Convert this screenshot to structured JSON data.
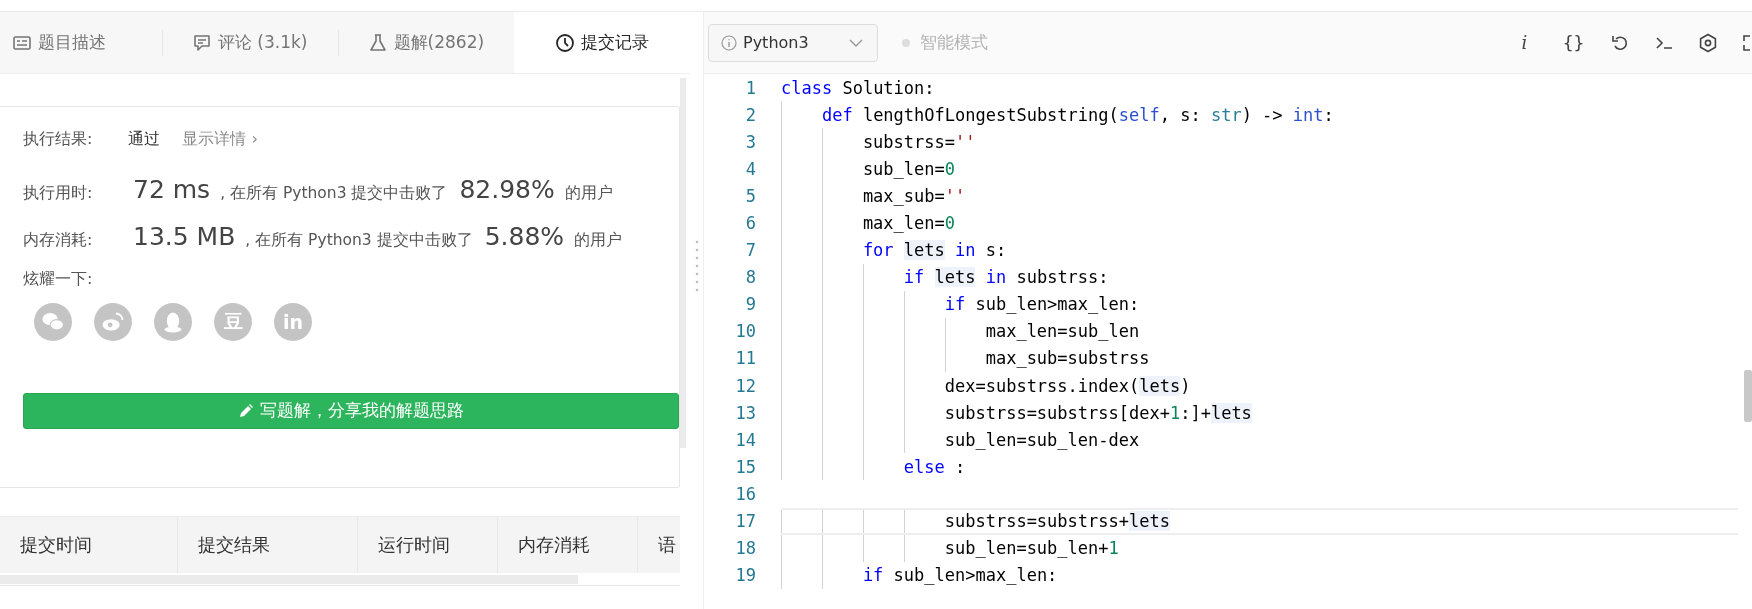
{
  "tabs": [
    {
      "label": "题目描述",
      "selected": false
    },
    {
      "label": "评论 (3.1k)",
      "selected": false
    },
    {
      "label": "题解(2862)",
      "selected": false
    },
    {
      "label": "提交记录",
      "selected": true
    }
  ],
  "result": {
    "label": "执行结果:",
    "status": "通过",
    "details_link": "显示详情 ›"
  },
  "stats": [
    {
      "label": "执行用时:",
      "value": "72 ms",
      "text": ", 在所有 Python3 提交中击败了",
      "percent": "82.98%",
      "suffix": "的用户"
    },
    {
      "label": "内存消耗:",
      "value": "13.5 MB",
      "text": ", 在所有 Python3 提交中击败了",
      "percent": "5.88%",
      "suffix": "的用户"
    }
  ],
  "share": {
    "label": "炫耀一下:",
    "items": [
      {
        "kind": "wechat"
      },
      {
        "kind": "weibo"
      },
      {
        "kind": "qq"
      },
      {
        "kind": "douban",
        "label": "豆"
      },
      {
        "kind": "linkedin",
        "label": "in"
      }
    ]
  },
  "write_button": "写题解，分享我的解题思路",
  "table": {
    "columns": [
      "提交时间",
      "提交结果",
      "运行时间",
      "内存消耗",
      "语"
    ]
  },
  "editor": {
    "language": "Python3",
    "smart_mode": {
      "label": "智能模式",
      "on": false
    },
    "toolbar": [
      {
        "kind": "text",
        "label": "i"
      },
      {
        "kind": "text",
        "label": "{}"
      },
      {
        "kind": "reset"
      },
      {
        "kind": "console"
      },
      {
        "kind": "settings"
      },
      {
        "kind": "fullscreen"
      }
    ],
    "lines": [
      {
        "number": "1",
        "current": false,
        "tokens": [
          {
            "kind": "keyword",
            "text": "class"
          },
          {
            "kind": "plain",
            "text": " Solution:"
          }
        ]
      },
      {
        "number": "2",
        "current": false,
        "tokens": [
          {
            "kind": "keyword",
            "text": "    def"
          },
          {
            "kind": "plain",
            "text": " lengthOfLongestSubstring("
          },
          {
            "kind": "builtin",
            "text": "self"
          },
          {
            "kind": "plain",
            "text": ", s: "
          },
          {
            "kind": "type",
            "text": "str"
          },
          {
            "kind": "plain",
            "text": ") -> "
          },
          {
            "kind": "builtin",
            "text": "int"
          },
          {
            "kind": "plain",
            "text": ":"
          }
        ]
      },
      {
        "number": "3",
        "current": false,
        "tokens": [
          {
            "kind": "plain",
            "text": "        substrss="
          },
          {
            "kind": "string",
            "text": "''"
          }
        ]
      },
      {
        "number": "4",
        "current": false,
        "tokens": [
          {
            "kind": "plain",
            "text": "        sub_len="
          },
          {
            "kind": "number",
            "text": "0"
          }
        ]
      },
      {
        "number": "5",
        "current": false,
        "tokens": [
          {
            "kind": "plain",
            "text": "        max_sub="
          },
          {
            "kind": "string",
            "text": "''"
          }
        ]
      },
      {
        "number": "6",
        "current": false,
        "tokens": [
          {
            "kind": "plain",
            "text": "        max_len="
          },
          {
            "kind": "number",
            "text": "0"
          }
        ]
      },
      {
        "number": "7",
        "current": false,
        "tokens": [
          {
            "kind": "keyword",
            "text": "        for "
          },
          {
            "kind": "match",
            "text": "lets"
          },
          {
            "kind": "keyword",
            "text": " in"
          },
          {
            "kind": "plain",
            "text": " s:"
          }
        ]
      },
      {
        "number": "8",
        "current": false,
        "tokens": [
          {
            "kind": "keyword",
            "text": "            if "
          },
          {
            "kind": "match",
            "text": "lets"
          },
          {
            "kind": "keyword",
            "text": " in"
          },
          {
            "kind": "plain",
            "text": " substrss:"
          }
        ]
      },
      {
        "number": "9",
        "current": false,
        "tokens": [
          {
            "kind": "keyword",
            "text": "                if"
          },
          {
            "kind": "plain",
            "text": " sub_len>max_len:"
          }
        ]
      },
      {
        "number": "10",
        "current": false,
        "tokens": [
          {
            "kind": "plain",
            "text": "                    max_len=sub_len"
          }
        ]
      },
      {
        "number": "11",
        "current": false,
        "tokens": [
          {
            "kind": "plain",
            "text": "                    max_sub=substrss"
          }
        ]
      },
      {
        "number": "12",
        "current": false,
        "tokens": [
          {
            "kind": "plain",
            "text": "                dex=substrss.index("
          },
          {
            "kind": "match",
            "text": "lets"
          },
          {
            "kind": "plain",
            "text": ")"
          }
        ]
      },
      {
        "number": "13",
        "current": false,
        "tokens": [
          {
            "kind": "plain",
            "text": "                substrss=substrss[dex+"
          },
          {
            "kind": "number",
            "text": "1"
          },
          {
            "kind": "plain",
            "text": ":]+"
          },
          {
            "kind": "match",
            "text": "lets"
          }
        ]
      },
      {
        "number": "14",
        "current": false,
        "tokens": [
          {
            "kind": "plain",
            "text": "                sub_len=sub_len-dex"
          }
        ]
      },
      {
        "number": "15",
        "current": false,
        "tokens": [
          {
            "kind": "keyword",
            "text": "            else"
          },
          {
            "kind": "plain",
            "text": " :"
          }
        ]
      },
      {
        "number": "16",
        "current": false
      },
      {
        "number": "17",
        "current": true,
        "tokens": [
          {
            "kind": "plain",
            "text": "                substrss=substrss+"
          },
          {
            "kind": "match",
            "text": "lets"
          }
        ]
      },
      {
        "number": "18",
        "current": false,
        "tokens": [
          {
            "kind": "plain",
            "text": "                sub_len=sub_len+"
          },
          {
            "kind": "number",
            "text": "1"
          }
        ]
      },
      {
        "number": "19",
        "current": false,
        "tokens": [
          {
            "kind": "keyword",
            "text": "        if"
          },
          {
            "kind": "plain",
            "text": " sub_len>max_len:"
          }
        ]
      }
    ]
  }
}
